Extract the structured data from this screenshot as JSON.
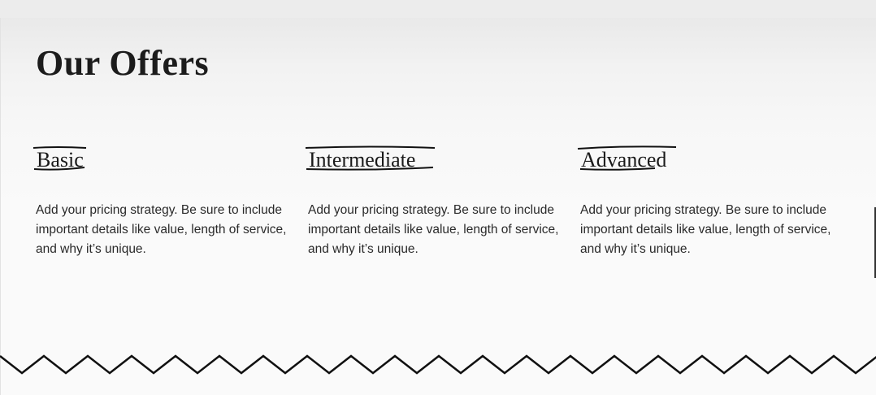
{
  "section": {
    "title": "Our Offers",
    "tiers": [
      {
        "name": "Basic",
        "description": "Add your pricing strategy. Be sure to include important details like value, length of service, and why it’s unique."
      },
      {
        "name": "Intermediate",
        "description": "Add your pricing strategy. Be sure to include important details like value, length of service, and why it’s unique."
      },
      {
        "name": "Advanced",
        "description": "Add your pricing strategy. Be sure to include important details like value, length of service, and why it’s unique."
      }
    ]
  },
  "colors": {
    "text": "#1a1a1a",
    "background": "#fafafa",
    "accent_line": "#111111"
  },
  "decor": {
    "divider": "zigzag-divider",
    "heading_underline": "hand-drawn-underline"
  }
}
